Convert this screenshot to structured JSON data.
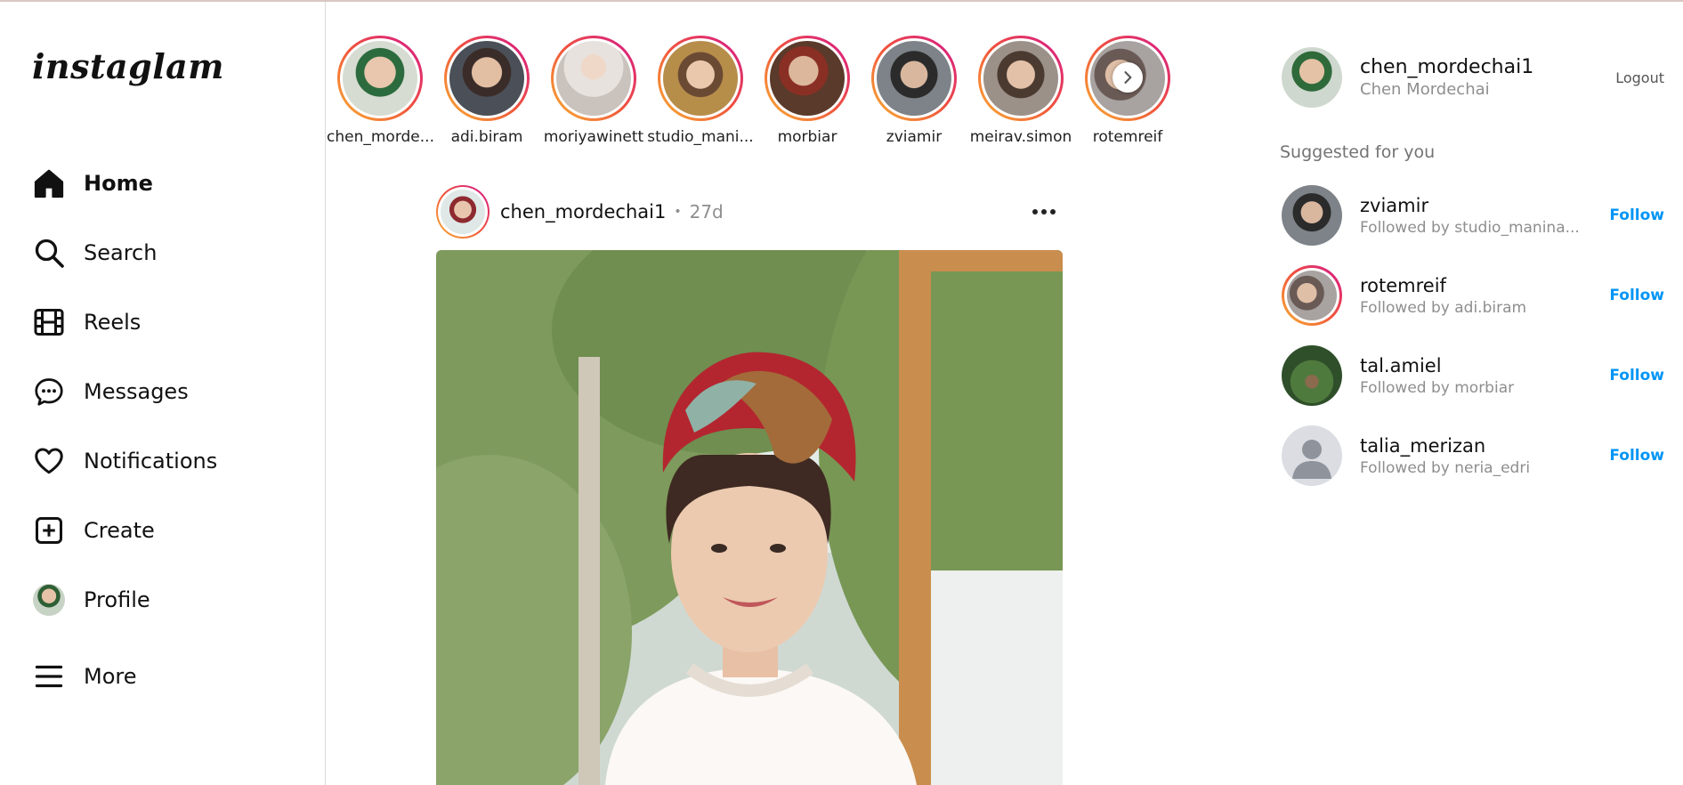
{
  "app": {
    "logo": "instaglam"
  },
  "sidebar": {
    "items": [
      {
        "label": "Home",
        "icon": "home-icon"
      },
      {
        "label": "Search",
        "icon": "search-icon"
      },
      {
        "label": "Reels",
        "icon": "reels-icon"
      },
      {
        "label": "Messages",
        "icon": "messages-icon"
      },
      {
        "label": "Notifications",
        "icon": "heart-icon"
      },
      {
        "label": "Create",
        "icon": "create-icon"
      },
      {
        "label": "Profile",
        "icon": "avatar"
      },
      {
        "label": "More",
        "icon": "menu-icon"
      }
    ]
  },
  "stories": [
    {
      "name": "chen_morde..."
    },
    {
      "name": "adi.biram"
    },
    {
      "name": "moriyawinett"
    },
    {
      "name": "studio_mani..."
    },
    {
      "name": "morbiar"
    },
    {
      "name": "zviamir"
    },
    {
      "name": "meirav.simon"
    },
    {
      "name": "rotemreif"
    }
  ],
  "post": {
    "username": "chen_mordechai1",
    "time": "27d"
  },
  "account": {
    "username": "chen_mordechai1",
    "full_name": "Chen Mordechai",
    "logout": "Logout"
  },
  "suggestions": {
    "title": "Suggested for you",
    "items": [
      {
        "username": "zviamir",
        "subtitle": "Followed by studio_manina...",
        "action": "Follow"
      },
      {
        "username": "rotemreif",
        "subtitle": "Followed by adi.biram",
        "action": "Follow"
      },
      {
        "username": "tal.amiel",
        "subtitle": "Followed by morbiar",
        "action": "Follow"
      },
      {
        "username": "talia_merizan",
        "subtitle": "Followed by neria_edri",
        "action": "Follow"
      }
    ]
  },
  "colors": {
    "accent": "#0095f6",
    "story_gradient": [
      "#f9b233",
      "#f0533c",
      "#d5168d"
    ]
  }
}
